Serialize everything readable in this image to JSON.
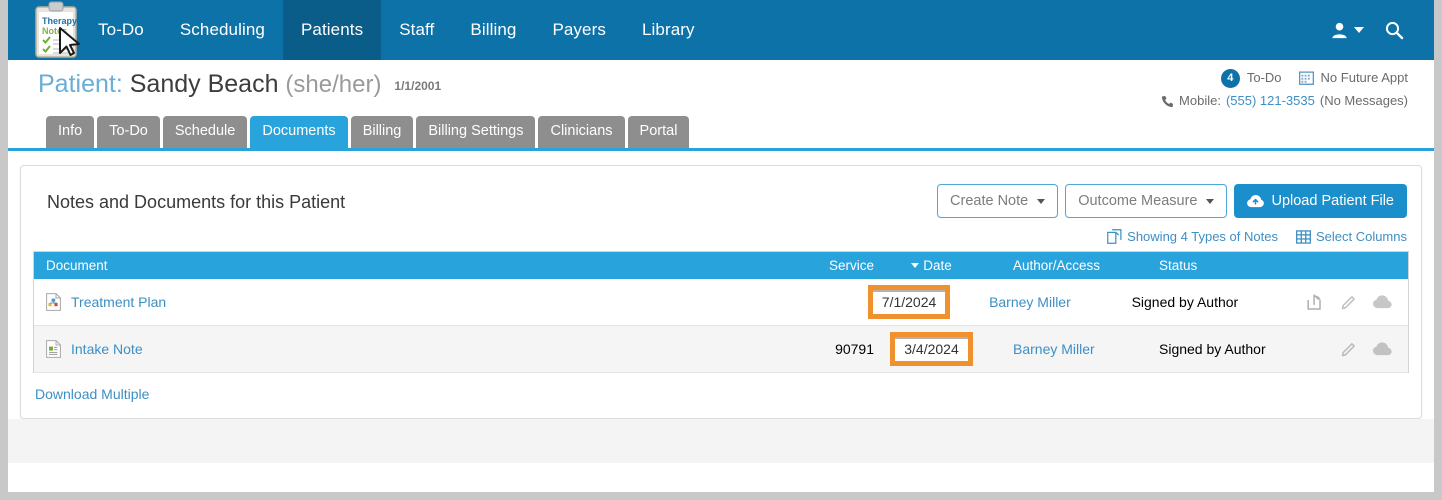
{
  "navbar": {
    "logo_alt": "TherapyNotes",
    "logo_line1": "Therapy",
    "logo_line2": "Notes",
    "links": [
      {
        "label": "To-Do",
        "active": false
      },
      {
        "label": "Scheduling",
        "active": false
      },
      {
        "label": "Patients",
        "active": true
      },
      {
        "label": "Staff",
        "active": false
      },
      {
        "label": "Billing",
        "active": false
      },
      {
        "label": "Payers",
        "active": false
      },
      {
        "label": "Library",
        "active": false
      }
    ],
    "user_icon": "user-icon",
    "search_icon": "search-icon",
    "bg_color": "#0d72a8",
    "active_color": "#0a5c89"
  },
  "patient_header": {
    "label": "Patient",
    "separator": ":",
    "name": "Sandy Beach",
    "pronouns": "(she/her)",
    "dob": "1/1/2001",
    "todo_count": "4",
    "todo_label": "To-Do",
    "appt_label": "No Future Appt",
    "appt_icon": "calendar-icon",
    "phone_icon": "phone-icon",
    "phone_label": "Mobile:",
    "phone_number": "(555) 121-3535",
    "messages_note": "(No Messages)"
  },
  "tabs": [
    {
      "label": "Info",
      "active": false
    },
    {
      "label": "To-Do",
      "active": false
    },
    {
      "label": "Schedule",
      "active": false
    },
    {
      "label": "Documents",
      "active": true
    },
    {
      "label": "Billing",
      "active": false
    },
    {
      "label": "Billing Settings",
      "active": false
    },
    {
      "label": "Clinicians",
      "active": false
    },
    {
      "label": "Portal",
      "active": false
    }
  ],
  "panel": {
    "title": "Notes and Documents for this Patient",
    "buttons": [
      {
        "label": "Create Note",
        "style": "outline",
        "dropdown": true
      },
      {
        "label": "Outcome Measure",
        "style": "outline",
        "dropdown": true
      },
      {
        "label": "Upload Patient File",
        "style": "primary",
        "dropdown": false,
        "icon": "cloud-upload-icon"
      }
    ],
    "links": [
      {
        "label": "Showing 4 Types of Notes",
        "icon": "notes-types-icon"
      },
      {
        "label": "Select Columns",
        "icon": "columns-grid-icon"
      }
    ],
    "download_multiple": "Download Multiple"
  },
  "table": {
    "columns": [
      "Document",
      "Service",
      "Date",
      "Author/Access",
      "Status"
    ],
    "sorted_column": "Date",
    "sort_direction": "desc",
    "highlight_color": "#f0912d",
    "header_color": "#29a3dc",
    "rows": [
      {
        "document": "Treatment Plan",
        "doc_icon": "treatment-plan-file-icon",
        "service": "",
        "date": "7/1/2024",
        "date_highlighted": true,
        "author": "Barney Miller",
        "status": "Signed by Author",
        "actions": [
          "share-icon",
          "edit-pencil-icon",
          "cloud-download-icon"
        ]
      },
      {
        "document": "Intake Note",
        "doc_icon": "intake-note-file-icon",
        "service": "90791",
        "date": "3/4/2024",
        "date_highlighted": true,
        "author": "Barney Miller",
        "status": "Signed by Author",
        "actions": [
          "edit-pencil-icon",
          "cloud-download-icon"
        ]
      }
    ]
  }
}
